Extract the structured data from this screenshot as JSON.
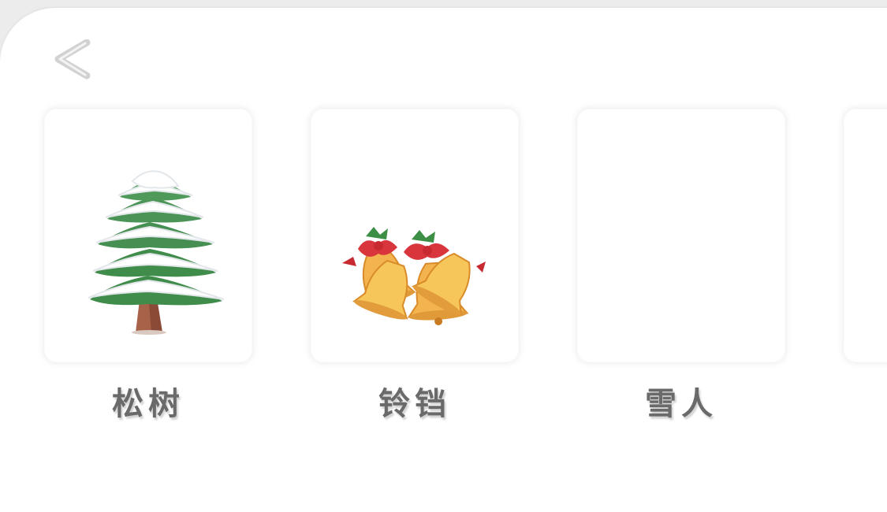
{
  "header": {
    "back_icon": "chevron-left-icon"
  },
  "items": [
    {
      "label": "松树",
      "icon": "snowy-pine-tree-icon"
    },
    {
      "label": "铃铛",
      "icon": "christmas-bells-icon"
    },
    {
      "label": "雪人",
      "icon": ""
    },
    {
      "label": "",
      "icon": ""
    }
  ]
}
